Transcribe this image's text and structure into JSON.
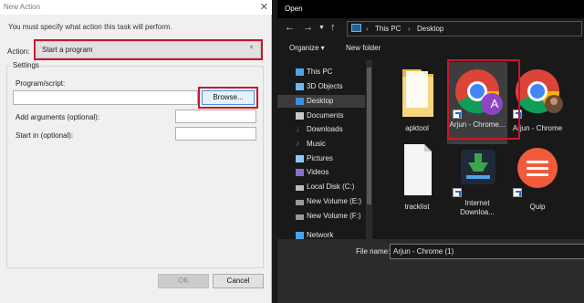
{
  "new_action_dialog": {
    "title": "New Action",
    "close_glyph": "✕",
    "instruction": "You must specify what action this task will perform.",
    "action_label": "Action:",
    "action_value": "Start a program",
    "settings_label": "Settings",
    "program_label": "Program/script:",
    "program_value": "",
    "browse_label": "Browse...",
    "arguments_label": "Add arguments (optional):",
    "arguments_value": "",
    "start_in_label": "Start in (optional):",
    "start_in_value": "",
    "ok_label": "OK",
    "cancel_label": "Cancel"
  },
  "open_dialog": {
    "title": "Open",
    "breadcrumb": [
      "This PC",
      "Desktop"
    ],
    "toolbar": {
      "organize": "Organize ▾",
      "new_folder": "New folder"
    },
    "nav_items": [
      {
        "label": "This PC",
        "icon": "pc-icon",
        "color": "#4ea3e8"
      },
      {
        "label": "3D Objects",
        "icon": "cube-icon",
        "color": "#6fb8f0"
      },
      {
        "label": "Desktop",
        "icon": "desktop-icon",
        "color": "#3f8fdc",
        "selected": true
      },
      {
        "label": "Documents",
        "icon": "document-icon",
        "color": "#c7c7c7"
      },
      {
        "label": "Downloads",
        "icon": "download-icon",
        "color": "#3f8fdc"
      },
      {
        "label": "Music",
        "icon": "music-icon",
        "color": "#3f8fdc"
      },
      {
        "label": "Pictures",
        "icon": "picture-icon",
        "color": "#8fc6f2"
      },
      {
        "label": "Videos",
        "icon": "video-icon",
        "color": "#8a6fd0"
      },
      {
        "label": "Local Disk (C:)",
        "icon": "drive-icon",
        "color": "#bbbbbb"
      },
      {
        "label": "New Volume (E:)",
        "icon": "drive-icon",
        "color": "#999999"
      },
      {
        "label": "New Volume (F:)",
        "icon": "drive-icon",
        "color": "#999999"
      },
      {
        "label": "Network",
        "icon": "network-icon",
        "color": "#4ea3e8"
      }
    ],
    "files": [
      {
        "name": "apktool",
        "icon": "folder-icon"
      },
      {
        "name": "Arjun - Chrome...",
        "icon": "chrome-shortcut-icon",
        "avatar_letter": "A",
        "selected": true
      },
      {
        "name": "Arjun - Chrome",
        "icon": "chrome-shortcut-photo-icon"
      },
      {
        "name": "tracklist",
        "icon": "text-file-icon"
      },
      {
        "name": "Internet Downloa...",
        "icon": "idm-icon"
      },
      {
        "name": "Quip",
        "icon": "quip-icon"
      }
    ],
    "file_name_label": "File name:",
    "file_name_value": "Arjun - Chrome (1)"
  },
  "colors": {
    "highlight_red": "#c8172e",
    "accent_blue": "#4d90d8",
    "chrome_red": "#db4437",
    "chrome_yellow": "#f4b400",
    "chrome_green": "#0f9d58",
    "chrome_blue": "#4285f4",
    "avatar_purple": "#8e44c4",
    "quip_red": "#f25a3c"
  }
}
